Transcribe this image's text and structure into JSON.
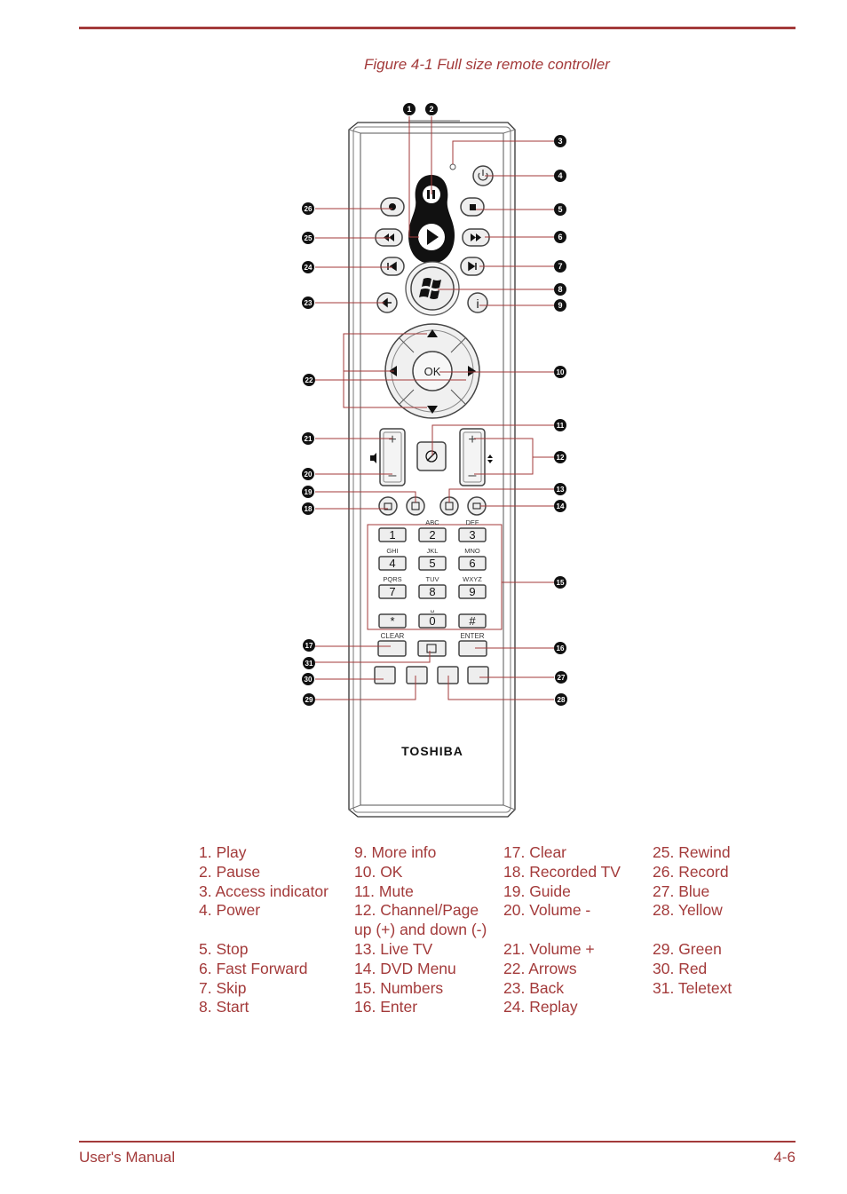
{
  "figure": {
    "caption": "Figure 4-1 Full size remote controller",
    "brand_logo": "TOSHIBA",
    "center_button_label": "OK",
    "keypad": {
      "keys": [
        {
          "digit": "1",
          "letters": ""
        },
        {
          "digit": "2",
          "letters": "ABC"
        },
        {
          "digit": "3",
          "letters": "DEF"
        },
        {
          "digit": "4",
          "letters": "GHI"
        },
        {
          "digit": "5",
          "letters": "JKL"
        },
        {
          "digit": "6",
          "letters": "MNO"
        },
        {
          "digit": "7",
          "letters": "PQRS"
        },
        {
          "digit": "8",
          "letters": "TUV"
        },
        {
          "digit": "9",
          "letters": "WXYZ"
        },
        {
          "digit": "*",
          "letters": ""
        },
        {
          "digit": "0",
          "letters": "␣"
        },
        {
          "digit": "#",
          "letters": ""
        }
      ],
      "clear_label": "CLEAR",
      "enter_label": "ENTER"
    },
    "volume_plus": "+",
    "volume_minus": "–",
    "callouts": [
      "1",
      "2",
      "3",
      "4",
      "5",
      "6",
      "7",
      "8",
      "9",
      "10",
      "11",
      "12",
      "13",
      "14",
      "15",
      "16",
      "17",
      "18",
      "19",
      "20",
      "21",
      "22",
      "23",
      "24",
      "25",
      "26",
      "27",
      "28",
      "29",
      "30",
      "31"
    ],
    "accent_color": "#a33a3a"
  },
  "legend": {
    "columns": [
      [
        [
          "1. Play"
        ],
        [
          "2. Pause"
        ],
        [
          "3. Access indicator"
        ],
        [
          "4. Power"
        ],
        [
          ""
        ],
        [
          "5. Stop"
        ],
        [
          "6. Fast Forward"
        ],
        [
          "7. Skip"
        ],
        [
          "8. Start"
        ]
      ],
      [
        [
          "9. More info"
        ],
        [
          "10. OK"
        ],
        [
          "11. Mute"
        ],
        [
          "12. Channel/Page"
        ],
        [
          "up (+) and down (-)"
        ],
        [
          "13. Live TV"
        ],
        [
          "14. DVD Menu"
        ],
        [
          "15. Numbers"
        ],
        [
          "16. Enter"
        ]
      ],
      [
        [
          "17. Clear"
        ],
        [
          "18. Recorded TV"
        ],
        [
          "19. Guide"
        ],
        [
          "20. Volume -"
        ],
        [
          ""
        ],
        [
          "21. Volume +"
        ],
        [
          "22. Arrows"
        ],
        [
          "23. Back"
        ],
        [
          "24. Replay"
        ]
      ],
      [
        [
          "25. Rewind"
        ],
        [
          "26. Record"
        ],
        [
          "27. Blue"
        ],
        [
          "28. Yellow"
        ],
        [
          ""
        ],
        [
          "29. Green"
        ],
        [
          "30. Red"
        ],
        [
          "31. Teletext"
        ],
        [
          ""
        ]
      ]
    ]
  },
  "footer": {
    "left": "User's Manual",
    "right": "4-6"
  }
}
